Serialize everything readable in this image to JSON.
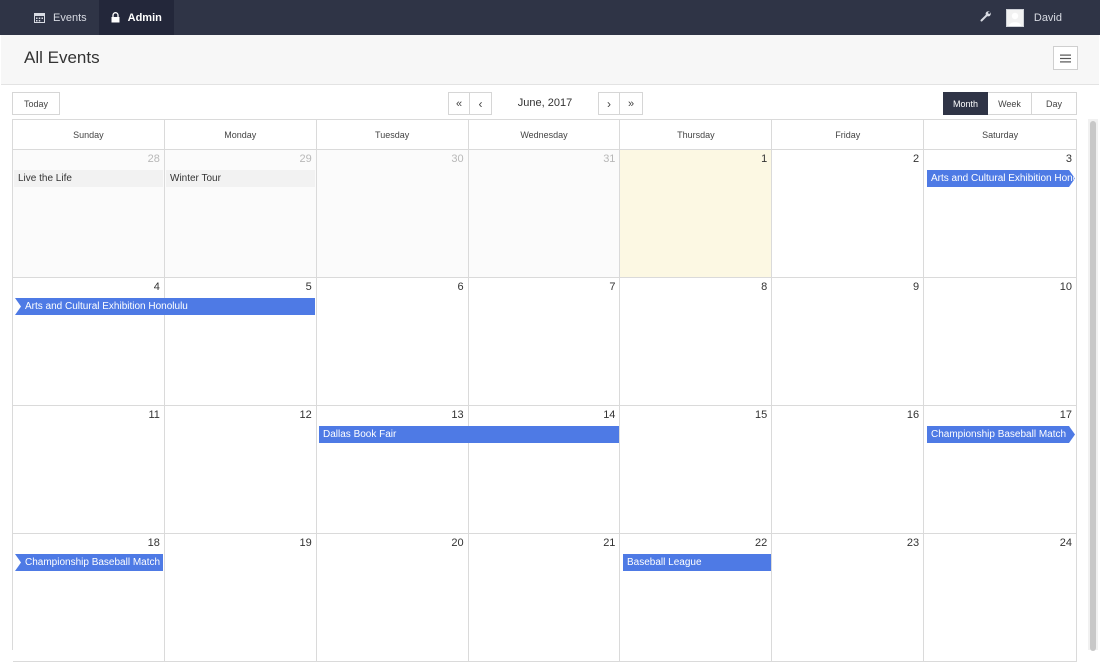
{
  "nav": {
    "events_label": "Events",
    "admin_label": "Admin",
    "user_name": "David"
  },
  "header": {
    "title": "All Events"
  },
  "toolbar": {
    "today_label": "Today",
    "month_label": "June, 2017",
    "prev_year": "«",
    "prev": "‹",
    "next": "›",
    "next_year": "»",
    "views": [
      "Month",
      "Week",
      "Day"
    ],
    "active_view": "Month"
  },
  "calendar": {
    "weekdays": [
      "Sunday",
      "Monday",
      "Tuesday",
      "Wednesday",
      "Thursday",
      "Friday",
      "Saturday"
    ],
    "weeks": [
      [
        {
          "day": "28",
          "other": true
        },
        {
          "day": "29",
          "other": true
        },
        {
          "day": "30",
          "other": true
        },
        {
          "day": "31",
          "other": true
        },
        {
          "day": "1",
          "today": true
        },
        {
          "day": "2"
        },
        {
          "day": "3"
        }
      ],
      [
        {
          "day": "4"
        },
        {
          "day": "5"
        },
        {
          "day": "6"
        },
        {
          "day": "7"
        },
        {
          "day": "8"
        },
        {
          "day": "9"
        },
        {
          "day": "10"
        }
      ],
      [
        {
          "day": "11"
        },
        {
          "day": "12"
        },
        {
          "day": "13"
        },
        {
          "day": "14"
        },
        {
          "day": "15"
        },
        {
          "day": "16"
        },
        {
          "day": "17"
        }
      ],
      [
        {
          "day": "18"
        },
        {
          "day": "19"
        },
        {
          "day": "20"
        },
        {
          "day": "21"
        },
        {
          "day": "22"
        },
        {
          "day": "23"
        },
        {
          "day": "24"
        }
      ]
    ],
    "events": [
      {
        "title": "Live the Life",
        "week": 0,
        "start": 0,
        "span": 1,
        "style": "grey",
        "shape": ""
      },
      {
        "title": "Winter Tour",
        "week": 0,
        "start": 1,
        "span": 1,
        "style": "grey",
        "shape": ""
      },
      {
        "title": "Arts and Cultural Exhibition Honolulu",
        "week": 0,
        "start": 6,
        "span": 1,
        "style": "blue",
        "shape": "tail-right"
      },
      {
        "title": "Arts and Cultural Exhibition Honolulu",
        "week": 1,
        "start": 0,
        "span": 2,
        "style": "blue",
        "shape": "head-left"
      },
      {
        "title": "Dallas Book Fair",
        "week": 2,
        "start": 2,
        "span": 2,
        "style": "blue",
        "shape": ""
      },
      {
        "title": "Championship Baseball Match",
        "week": 2,
        "start": 6,
        "span": 1,
        "style": "blue",
        "shape": "tail-right"
      },
      {
        "title": "Championship Baseball Match",
        "week": 3,
        "start": 0,
        "span": 1,
        "style": "blue",
        "shape": "head-left"
      },
      {
        "title": "Baseball League",
        "week": 3,
        "start": 4,
        "span": 1,
        "style": "blue",
        "shape": ""
      }
    ]
  }
}
